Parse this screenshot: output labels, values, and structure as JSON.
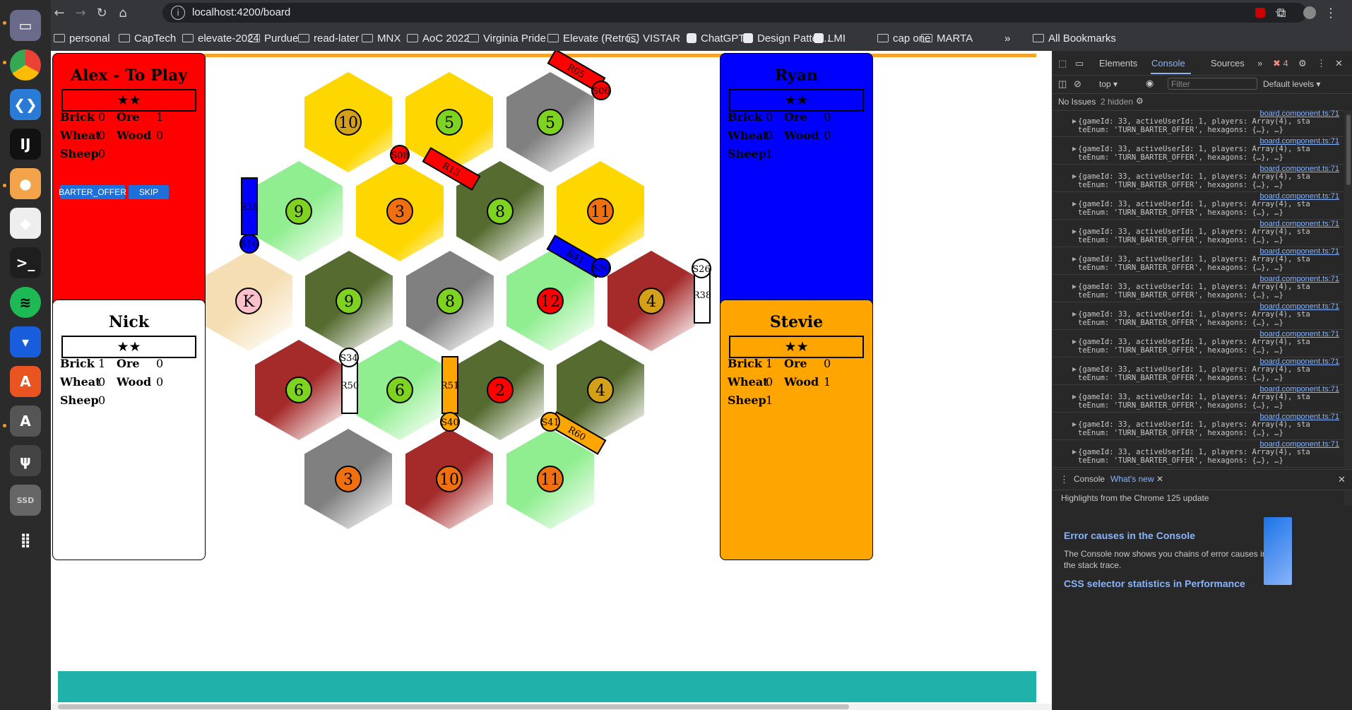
{
  "browser": {
    "url": "localhost:4200/board",
    "bookmarks": [
      "personal",
      "CapTech",
      "elevate-2024",
      "Purdue",
      "read-later",
      "MNX",
      "AoC 2022",
      "Virginia Pride",
      "Elevate (Retros)",
      "VISTAR",
      "ChatGPT",
      "Design Patter...",
      "LMI",
      "cap one",
      "MARTA"
    ],
    "all_bookmarks": "All Bookmarks",
    "overflow": "»"
  },
  "dock": {
    "icons": [
      "files-icon",
      "chrome-icon",
      "vscode-icon",
      "intellij-icon",
      "dog-app-icon",
      "postman-icon",
      "terminal-icon",
      "spotify-icon",
      "bitwarden-icon",
      "app-store-icon",
      "software-updater-icon",
      "usb-icon",
      "ssd-icon",
      "apps-grid-icon"
    ],
    "ssd_label": "SSD"
  },
  "players": [
    {
      "name": "Alex - To Play",
      "stars": "★★",
      "bg": "#ff0000",
      "brick": "0",
      "ore": "1",
      "wheat": "0",
      "wood": "0",
      "sheep": "0",
      "barter_label": "BARTER_OFFER",
      "skip_label": "SKIP"
    },
    {
      "name": "Ryan",
      "stars": "★★",
      "bg": "#0000ff",
      "brick": "0",
      "ore": "0",
      "wheat": "0",
      "wood": "0",
      "sheep": "1"
    },
    {
      "name": "Nick",
      "stars": "★★",
      "bg": "#ffffff",
      "brick": "1",
      "ore": "0",
      "wheat": "0",
      "wood": "0",
      "sheep": "0"
    },
    {
      "name": "Stevie",
      "stars": "★★",
      "bg": "#ffa500",
      "brick": "1",
      "ore": "0",
      "wheat": "0",
      "wood": "1",
      "sheep": "1"
    }
  ],
  "labels": {
    "brick": "Brick",
    "ore": "Ore",
    "wheat": "Wheat",
    "wood": "Wood",
    "sheep": "Sheep"
  },
  "board": {
    "hexes": [
      {
        "resource": "wheat",
        "number": "10",
        "chip": "#d4a017"
      },
      {
        "resource": "wheat",
        "number": "5",
        "chip": "#7ed321"
      },
      {
        "resource": "ore",
        "number": "5",
        "chip": "#7ed321"
      },
      {
        "resource": "sheep",
        "number": "9",
        "chip": "#7ed321"
      },
      {
        "resource": "wheat",
        "number": "3",
        "chip": "#f07010"
      },
      {
        "resource": "wood",
        "number": "8",
        "chip": "#7ed321"
      },
      {
        "resource": "wheat",
        "number": "11",
        "chip": "#f07010"
      },
      {
        "resource": "desert",
        "number": "K",
        "chip": "#ffc0cb"
      },
      {
        "resource": "wood",
        "number": "9",
        "chip": "#7ed321"
      },
      {
        "resource": "ore",
        "number": "8",
        "chip": "#7ed321"
      },
      {
        "resource": "sheep",
        "number": "12",
        "chip": "#ff0000"
      },
      {
        "resource": "brick",
        "number": "4",
        "chip": "#d4a017"
      },
      {
        "resource": "brick",
        "number": "6",
        "chip": "#7ed321"
      },
      {
        "resource": "sheep",
        "number": "6",
        "chip": "#7ed321"
      },
      {
        "resource": "wood",
        "number": "2",
        "chip": "#ff0000"
      },
      {
        "resource": "wood",
        "number": "4",
        "chip": "#d4a017"
      },
      {
        "resource": "ore",
        "number": "3",
        "chip": "#f07010"
      },
      {
        "resource": "brick",
        "number": "10",
        "chip": "#f07010"
      },
      {
        "resource": "sheep",
        "number": "11",
        "chip": "#f07010"
      }
    ],
    "roads": [
      {
        "label": "R05",
        "color": "#ff0000"
      },
      {
        "label": "R13",
        "color": "#ff0000"
      },
      {
        "label": "R18",
        "color": "#0000ff"
      },
      {
        "label": "R41",
        "color": "#0000ff"
      },
      {
        "label": "R38",
        "color": "#ffffff"
      },
      {
        "label": "R50",
        "color": "#ffffff"
      },
      {
        "label": "R51",
        "color": "#ffa500"
      },
      {
        "label": "R60",
        "color": "#ffa500"
      }
    ],
    "settlements": [
      {
        "label": "S06",
        "color": "#ff0000"
      },
      {
        "label": "S08",
        "color": "#ff0000"
      },
      {
        "label": "S16",
        "color": "#0000ff"
      },
      {
        "label": "S30",
        "color": "#0000ff"
      },
      {
        "label": "S26",
        "color": "#ffffff"
      },
      {
        "label": "S34",
        "color": "#ffffff"
      },
      {
        "label": "S40",
        "color": "#ffa500"
      },
      {
        "label": "S41",
        "color": "#ffa500"
      }
    ]
  },
  "devtools": {
    "tabs": [
      "Elements",
      "Console",
      "Sources"
    ],
    "active_tab": "Console",
    "error_count": "4",
    "context": "top",
    "filter_placeholder": "Filter",
    "levels": "Default levels",
    "issues": "No Issues",
    "hidden": "2 hidden",
    "log_source": "board.component.ts:71",
    "log_line1": "{gameId: 33, activeUserId: 1, players: Array(4), sta",
    "log_line2": "teEnum: 'TURN_BARTER_OFFER', hexagons: {…}, …}",
    "log_count": 13,
    "drawer_tabs": [
      "Console",
      "What's new"
    ],
    "drawer_highlight": "Highlights from the Chrome 125 update",
    "drawer_item1_title": "Error causes in the Console",
    "drawer_item1_text": "The Console now shows you chains of error causes in the stack trace.",
    "drawer_item2_title": "CSS selector statistics in Performance"
  }
}
